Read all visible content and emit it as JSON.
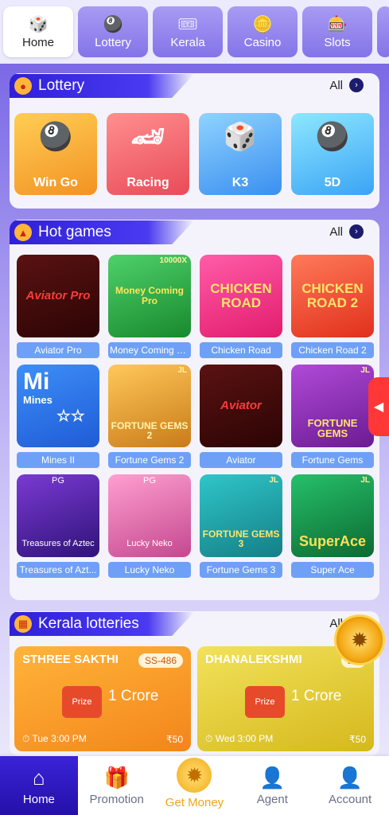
{
  "top_tabs": [
    {
      "label": "Home",
      "icon": "home-icon",
      "glyph": "🎲"
    },
    {
      "label": "Lottery",
      "icon": "lottery-icon",
      "glyph": "🎱"
    },
    {
      "label": "Kerala",
      "icon": "kerala-icon",
      "glyph": "🎟"
    },
    {
      "label": "Casino",
      "icon": "casino-icon",
      "glyph": "🪙"
    },
    {
      "label": "Slots",
      "icon": "slots-icon",
      "glyph": "🎰"
    }
  ],
  "lottery": {
    "title": "Lottery",
    "all_label": "All",
    "tiles": [
      {
        "label": "Win Go",
        "glyph": "🎱"
      },
      {
        "label": "Racing",
        "glyph": "🏎"
      },
      {
        "label": "K3",
        "glyph": "🎲"
      },
      {
        "label": "5D",
        "glyph": "🎱"
      }
    ]
  },
  "hot_games": {
    "title": "Hot games",
    "all_label": "All",
    "games": [
      {
        "name": "Aviator Pro",
        "art": "Aviator Pro"
      },
      {
        "name": "Money Coming P...",
        "art": "Money Coming Pro",
        "badge": "10000X"
      },
      {
        "name": "Chicken Road",
        "art": "CHICKEN ROAD"
      },
      {
        "name": "Chicken Road 2",
        "art": "CHICKEN ROAD 2"
      },
      {
        "name": "Mines II",
        "art_big": "Mi",
        "art_small": "Mines"
      },
      {
        "name": "Fortune Gems 2",
        "art": "FORTUNE GEMS 2",
        "badge": "JL"
      },
      {
        "name": "Aviator",
        "art": "Aviator"
      },
      {
        "name": "Fortune Gems",
        "art": "FORTUNE GEMS",
        "badge": "JL"
      },
      {
        "name": "Treasures of Azt...",
        "art": "Treasures of Aztec",
        "badge": "PG"
      },
      {
        "name": "Lucky Neko",
        "art": "Lucky Neko",
        "badge": "PG"
      },
      {
        "name": "Fortune Gems 3",
        "art": "FORTUNE GEMS 3",
        "badge": "JL"
      },
      {
        "name": "Super Ace",
        "art": "SuperAce",
        "badge": "JL"
      }
    ]
  },
  "kerala": {
    "title": "Kerala lotteries",
    "all_label": "All",
    "cards": [
      {
        "name": "STHREE SAKTHI",
        "code": "SS-486",
        "prize_label": "Prize",
        "amount": "1 Crore",
        "time": "Tue 3:00 PM",
        "price": "₹50"
      },
      {
        "name": "DHANALEKSHMI",
        "code": "DL",
        "prize_label": "Prize",
        "amount": "1 Crore",
        "time": "Wed 3:00 PM",
        "price": "₹50"
      }
    ]
  },
  "bottom_nav": [
    {
      "label": "Home",
      "icon": "home-icon",
      "glyph": "⌂"
    },
    {
      "label": "Promotion",
      "icon": "gift-icon",
      "glyph": "🎁"
    },
    {
      "label": "Get Money",
      "icon": "wheel-icon",
      "glyph": "✹"
    },
    {
      "label": "Agent",
      "icon": "agent-icon",
      "glyph": "👤"
    },
    {
      "label": "Account",
      "icon": "account-icon",
      "glyph": "👤"
    }
  ],
  "colors": {
    "accent": "#3a23d8",
    "tab_purple": "#8374e8",
    "label_blue": "#6fa0f7"
  }
}
